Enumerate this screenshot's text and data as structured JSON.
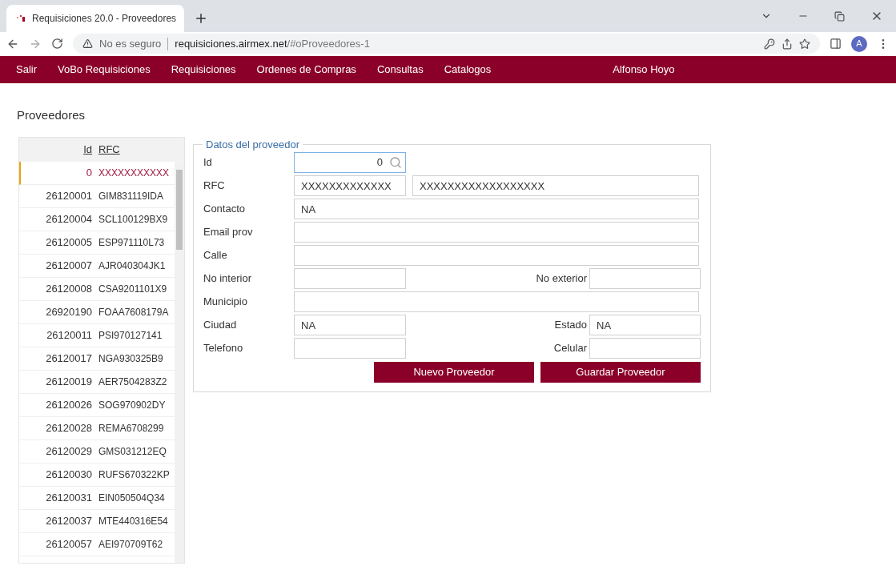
{
  "browser": {
    "tab_title": "Requisiciones 20.0 - Proveedores",
    "security": "No es seguro",
    "url_host": "requisiciones.airmex.net",
    "url_path": "/#oProveedores-1",
    "avatar": "A"
  },
  "nav": {
    "items": [
      "Salir",
      "VoBo Requisiciones",
      "Requisiciones",
      "Ordenes de Compras",
      "Consultas",
      "Catalogos"
    ],
    "user": "Alfonso Hoyo"
  },
  "page_title": "Proveedores",
  "table": {
    "columns": [
      "Id",
      "RFC"
    ],
    "rows": [
      {
        "id": "0",
        "rfc": "XXXXXXXXXXX",
        "selected": true
      },
      {
        "id": "26120001",
        "rfc": "GIM831119IDA",
        "selected": false
      },
      {
        "id": "26120004",
        "rfc": "SCL100129BX9",
        "selected": false
      },
      {
        "id": "26120005",
        "rfc": "ESP971110L73",
        "selected": false
      },
      {
        "id": "26120007",
        "rfc": "AJR040304JK1",
        "selected": false
      },
      {
        "id": "26120008",
        "rfc": "CSA9201101X9",
        "selected": false
      },
      {
        "id": "26920190",
        "rfc": "FOAA7608179A",
        "selected": false
      },
      {
        "id": "26120011",
        "rfc": "PSI970127141",
        "selected": false
      },
      {
        "id": "26120017",
        "rfc": "NGA930325B9",
        "selected": false
      },
      {
        "id": "26120019",
        "rfc": "AER7504283Z2",
        "selected": false
      },
      {
        "id": "26120026",
        "rfc": "SOG970902DY",
        "selected": false
      },
      {
        "id": "26120028",
        "rfc": "REMA6708299",
        "selected": false
      },
      {
        "id": "26120029",
        "rfc": "GMS031212EQ",
        "selected": false
      },
      {
        "id": "26120030",
        "rfc": "RUFS670322KP",
        "selected": false
      },
      {
        "id": "26120031",
        "rfc": "EIN050504Q34",
        "selected": false
      },
      {
        "id": "26120037",
        "rfc": "MTE440316E54",
        "selected": false
      },
      {
        "id": "26120057",
        "rfc": "AEI970709T62",
        "selected": false
      }
    ]
  },
  "form": {
    "legend": "Datos del proveedor",
    "id": {
      "label": "Id",
      "value": "0"
    },
    "rfc": {
      "label": "RFC",
      "value": "XXXXXXXXXXXXX",
      "value2": "XXXXXXXXXXXXXXXXXX"
    },
    "contacto": {
      "label": "Contacto",
      "value": "NA"
    },
    "email": {
      "label": "Email prov"
    },
    "calle": {
      "label": "Calle"
    },
    "no_interior": {
      "label": "No interior"
    },
    "no_exterior": {
      "label": "No exterior"
    },
    "municipio": {
      "label": "Municipio"
    },
    "ciudad": {
      "label": "Ciudad",
      "value": "NA"
    },
    "estado": {
      "label": "Estado",
      "value": "NA"
    },
    "telefono": {
      "label": "Telefono"
    },
    "celular": {
      "label": "Celular"
    },
    "buttons": [
      "Nuevo Proveedor",
      "Guardar Proveedor"
    ]
  }
}
